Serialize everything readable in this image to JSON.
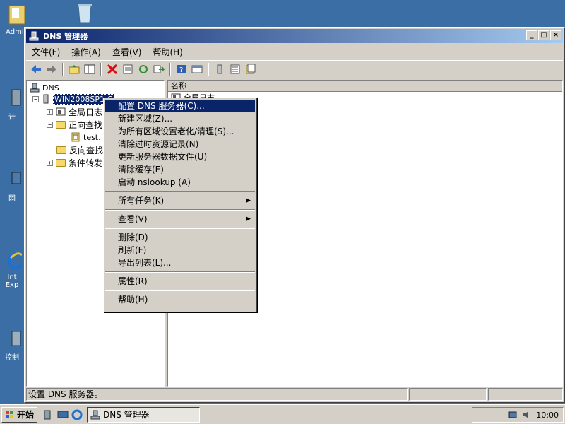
{
  "desktop": {
    "icons": [
      {
        "label": "Admin"
      },
      {
        "label": "计"
      },
      {
        "label": "网"
      },
      {
        "label": "Int Exp"
      },
      {
        "label": "控制"
      }
    ]
  },
  "window": {
    "title": "DNS 管理器",
    "menu": [
      "文件(F)",
      "操作(A)",
      "查看(V)",
      "帮助(H)"
    ]
  },
  "tree": {
    "root": "DNS",
    "server": "WIN2008SP1-C",
    "items": [
      "全局日志",
      "正向查找",
      "test.",
      "反向查找",
      "条件转发"
    ]
  },
  "list": {
    "column_name": "名称",
    "rows": [
      "全局日志"
    ]
  },
  "context_menu": {
    "items": [
      "配置 DNS 服务器(C)...",
      "新建区域(Z)...",
      "为所有区域设置老化/清理(S)...",
      "清除过时资源记录(N)",
      "更新服务器数据文件(U)",
      "清除缓存(E)",
      "启动 nslookup (A)",
      "所有任务(K)",
      "查看(V)",
      "删除(D)",
      "刷新(F)",
      "导出列表(L)...",
      "属性(R)",
      "帮助(H)"
    ]
  },
  "status": {
    "text": "设置 DNS 服务器。"
  },
  "taskbar": {
    "start_label": "开始",
    "task_label": "DNS 管理器",
    "clock": "10:00"
  },
  "colors": {
    "desktop": "#3a6ea5",
    "title_active": "#0a246a",
    "face": "#d4d0c8"
  }
}
